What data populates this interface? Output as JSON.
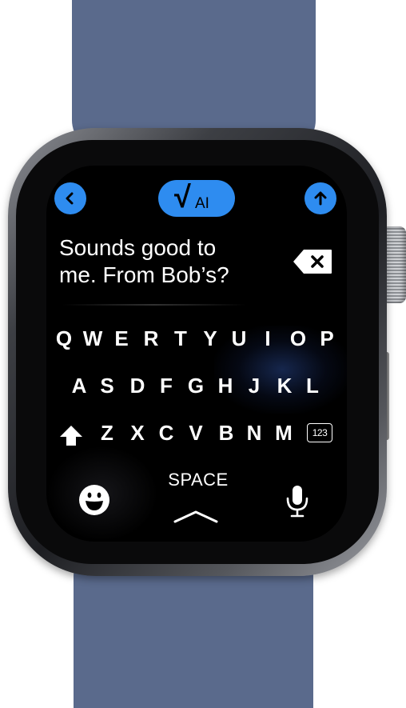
{
  "toolbar": {
    "back_icon": "chevron-left-icon",
    "ai_check": "√",
    "ai_label": "AI",
    "send_icon": "arrow-up-icon",
    "accent_color": "#2e8cf0"
  },
  "message": {
    "line1": "Sounds good to",
    "line2": "me. From Bob’s?"
  },
  "keyboard": {
    "row1": [
      "Q",
      "W",
      "E",
      "R",
      "T",
      "Y",
      "U",
      "I",
      "O",
      "P"
    ],
    "row2": [
      "A",
      "S",
      "D",
      "F",
      "G",
      "H",
      "J",
      "K",
      "L"
    ],
    "row3": [
      "Z",
      "X",
      "C",
      "V",
      "B",
      "N",
      "M"
    ],
    "numbers_label": "123",
    "space_label": "SPACE",
    "icons": [
      "shift-icon",
      "delete-icon",
      "emoji-icon",
      "microphone-icon",
      "chevron-up-icon"
    ]
  },
  "device": {
    "band_color": "#5a6a8c"
  }
}
